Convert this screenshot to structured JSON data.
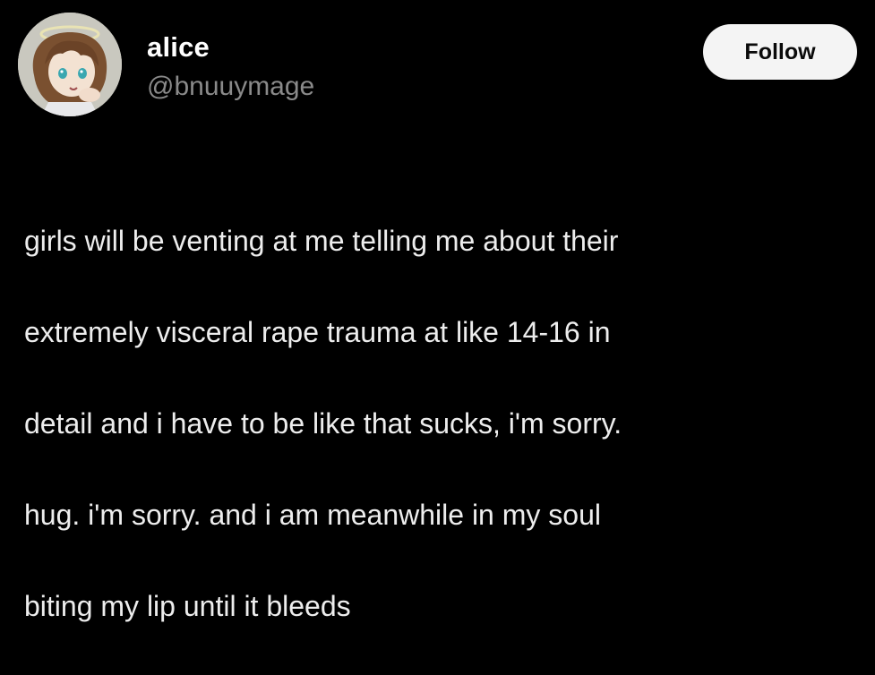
{
  "user": {
    "display_name": "alice",
    "handle": "@bnuuymage",
    "avatar_icon": "anime-character-avatar-icon"
  },
  "actions": {
    "follow_label": "Follow"
  },
  "post": {
    "lines": [
      "girls will be venting at me telling me about their",
      "extremely visceral rape trauma at like 14-16 in",
      "detail and i have to be like that sucks, i'm sorry.",
      "hug. i'm sorry. and i am meanwhile in my soul",
      "biting my lip until it bleeds"
    ]
  },
  "colors": {
    "background": "#000000",
    "text": "#ededed",
    "handle": "#8a8a8a",
    "follow_bg": "#f4f4f4",
    "follow_text": "#0a0a0a"
  }
}
